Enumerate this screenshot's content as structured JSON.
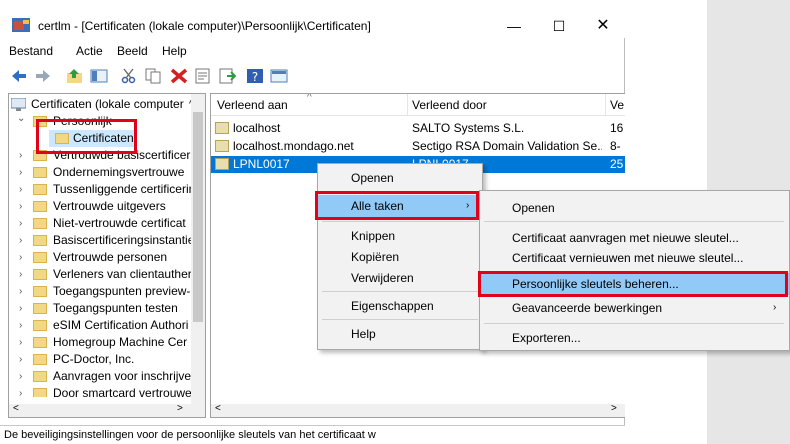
{
  "window": {
    "title": "certlm - [Certificaten (lokale computer)\\Persoonlijk\\Certificaten]",
    "min": "—",
    "max": "☐",
    "close": "✕"
  },
  "menubar": [
    "Bestand",
    "Actie",
    "Beeld",
    "Help"
  ],
  "tree": {
    "items": [
      {
        "label": "Certificaten (lokale computer",
        "chev": ""
      },
      {
        "label": "Persoonlijk",
        "chev": "⌄"
      },
      {
        "label": "Certificaten",
        "chev": ""
      },
      {
        "label": "Vertrouwde basiscertificer",
        "chev": "›"
      },
      {
        "label": "Ondernemingsvertrouwe",
        "chev": "›"
      },
      {
        "label": "Tussenliggende certificerin",
        "chev": "›"
      },
      {
        "label": "Vertrouwde uitgevers",
        "chev": "›"
      },
      {
        "label": "Niet-vertrouwde certificat",
        "chev": "›"
      },
      {
        "label": "Basiscertificeringsinstantie",
        "chev": "›"
      },
      {
        "label": "Vertrouwde personen",
        "chev": "›"
      },
      {
        "label": "Verleners van clientauther",
        "chev": "›"
      },
      {
        "label": "Toegangspunten preview-",
        "chev": "›"
      },
      {
        "label": "Toegangspunten testen",
        "chev": "›"
      },
      {
        "label": "eSIM Certification Authori",
        "chev": "›"
      },
      {
        "label": "Homegroup Machine Cer",
        "chev": "›"
      },
      {
        "label": "PC-Doctor, Inc.",
        "chev": "›"
      },
      {
        "label": "Aanvragen voor inschrijve",
        "chev": "›"
      },
      {
        "label": "Door smartcard vertrouwe",
        "chev": "›"
      }
    ]
  },
  "list": {
    "headers": [
      "Verleend aan",
      "Verleend door",
      "Ve"
    ],
    "rows": [
      {
        "issued_to": "localhost",
        "issued_by": "SALTO Systems S.L.",
        "exp": "16"
      },
      {
        "issued_to": "localhost.mondago.net",
        "issued_by": "Sectigo RSA Domain Validation Se...",
        "exp": "8-"
      },
      {
        "issued_to": "LPNL0017",
        "issued_by": "LPNL0017",
        "exp": "25"
      }
    ]
  },
  "context_menu": {
    "items": [
      "Openen",
      "Alle taken",
      "Knippen",
      "Kopiëren",
      "Verwijderen",
      "Eigenschappen",
      "Help"
    ]
  },
  "submenu": {
    "items": [
      "Openen",
      "Certificaat aanvragen met nieuwe sleutel...",
      "Certificaat vernieuwen met nieuwe sleutel...",
      "Persoonlijke sleutels beheren...",
      "Geavanceerde bewerkingen",
      "Exporteren..."
    ]
  },
  "status": "De beveiligingsinstellingen voor de persoonlijke sleutels van het certificaat w",
  "colors": {
    "highlight": "#e2001a",
    "selection": "#0078d7"
  }
}
